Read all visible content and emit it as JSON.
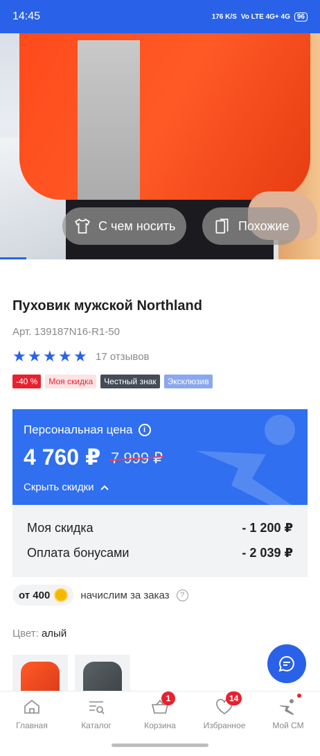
{
  "status_bar": {
    "time": "14:45",
    "net_speed": "176 K/S",
    "network": "Vo LTE 4G+ 4G",
    "battery": "96"
  },
  "hero": {
    "wear_with_label": "С чем носить",
    "similar_label": "Похожие"
  },
  "product": {
    "title": "Пуховик мужской Northland",
    "article": "Арт. 139187N16-R1-50",
    "reviews": "17 отзывов",
    "rating_stars": 5,
    "badges": [
      "-40 %",
      "Моя скидка",
      "Честный знак",
      "Эксклюзив"
    ]
  },
  "price": {
    "label": "Персональная цена",
    "current": "4 760 ₽",
    "old": "7 999 ₽",
    "toggle": "Скрыть скидки",
    "accent_color": "#2f6ff0"
  },
  "discounts": [
    {
      "label": "Моя скидка",
      "value": "- 1 200 ₽"
    },
    {
      "label": "Оплата бонусами",
      "value": "- 2 039 ₽"
    }
  ],
  "bonus": {
    "chip": "от 400",
    "text": "начислим за заказ"
  },
  "color": {
    "key": "Цвет:",
    "value": "алый"
  },
  "nav": [
    {
      "label": "Главная",
      "icon": "home-icon"
    },
    {
      "label": "Каталог",
      "icon": "catalog-icon"
    },
    {
      "label": "Корзина",
      "icon": "cart-icon",
      "badge": "1"
    },
    {
      "label": "Избранное",
      "icon": "heart-icon",
      "badge": "14"
    },
    {
      "label": "Мой СМ",
      "icon": "profile-icon"
    }
  ]
}
